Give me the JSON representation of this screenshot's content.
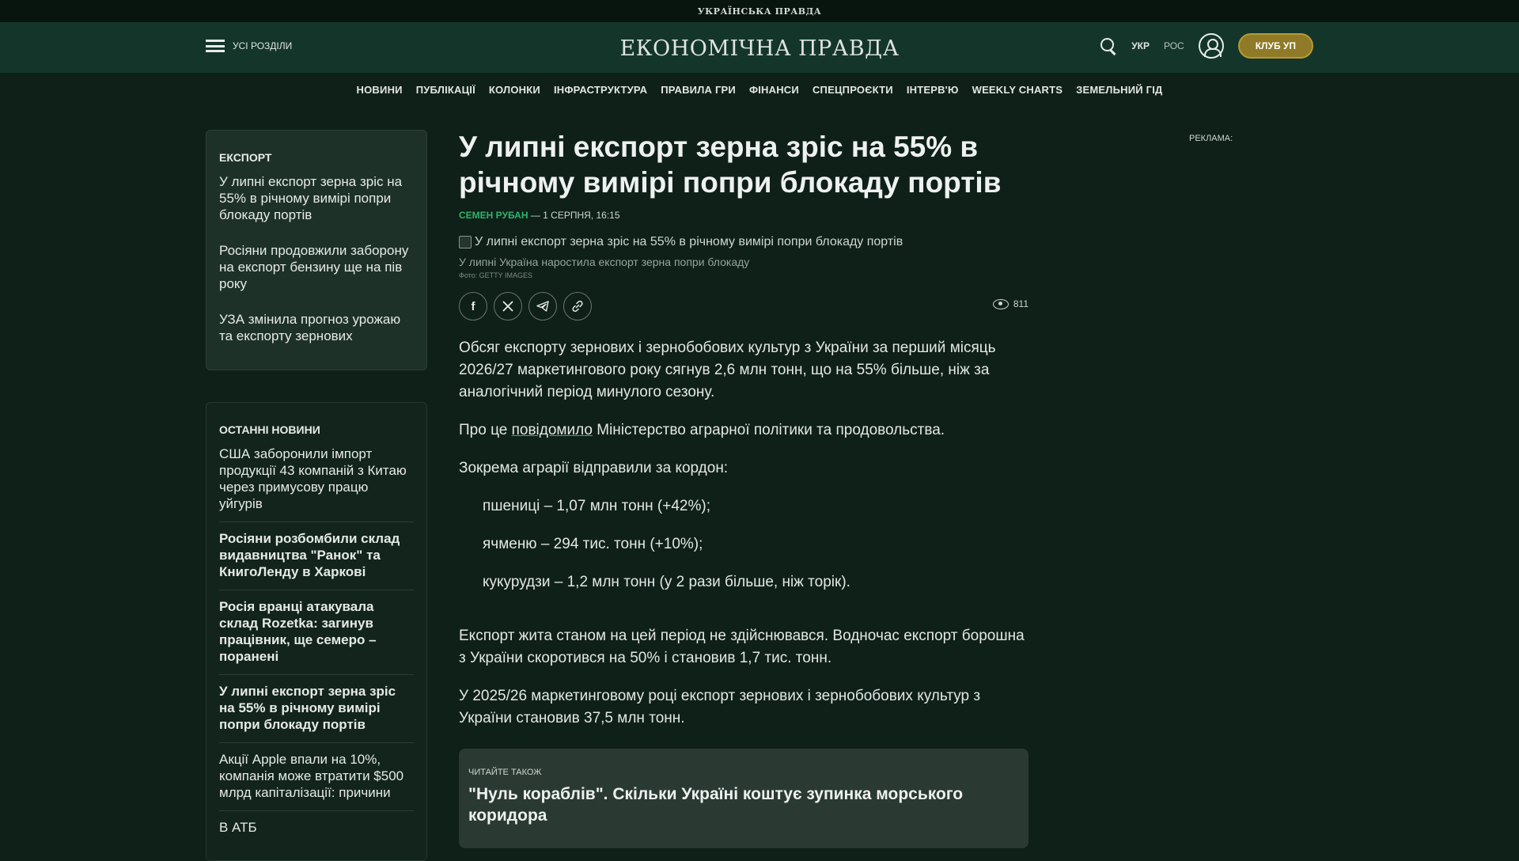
{
  "topbar": {
    "brand": "УКРАЇНСЬКА ПРАВДА"
  },
  "header": {
    "menu_label": "УСІ РОЗДІЛИ",
    "logo": "ЕКОНОМІЧНА ПРАВДА",
    "lang_ukr": "УКР",
    "lang_ros": "РОС",
    "club_button": "КЛУБ УП"
  },
  "nav": {
    "items": [
      "НОВИНИ",
      "ПУБЛІКАЦІЇ",
      "КОЛОНКИ",
      "ІНФРАСТРУКТУРА",
      "ПРАВИЛА ГРИ",
      "ФІНАНСИ",
      "СПЕЦПРОЄКТИ",
      "ІНТЕРВ'Ю",
      "WEEKLY CHARTS",
      "ЗЕМЕЛЬНИЙ ГІД"
    ]
  },
  "export_box": {
    "title": "ЕКСПОРТ",
    "items": [
      "У липні експорт зерна зріс на 55% в річному вимірі попри блокаду портів",
      "Росіяни продовжили заборону на експорт бензину ще на пів року",
      "УЗА змінила прогноз урожаю та експорту зернових"
    ]
  },
  "latest_box": {
    "title": "ОСТАННІ НОВИНИ",
    "items": [
      "США заборонили імпорт продукції 43 компаній з Китаю через примусову працю уйгурів",
      "Росіяни розбомбили склад видавництва \"Ранок\" та КнигоЛенду в Харкові",
      "Росія вранці атакувала склад Rozetka: загинув працівник, ще семеро – поранені",
      "У липні експорт зерна зріс на 55% в річному вимірі попри блокаду портів",
      "Акції Apple впали на 10%, компанія може втратити $500 млрд капіталізації: причини",
      "В АТБ"
    ]
  },
  "article": {
    "title": "У липні експорт зерна зріс на 55% в річному вимірі попри блокаду портів",
    "author": "СЕМЕН РУБАН",
    "date": "— 1 СЕРПНЯ, 16:15",
    "image_alt": "У липні експорт зерна зріс на 55% в річному вимірі попри блокаду портів",
    "caption": "У липні Україна наростила експорт зерна попри блокаду",
    "photo_credit": "Фото: GETTY IMAGES",
    "views": "811",
    "p1": "Обсяг експорту зернових і зернобобових культур з України за перший місяць 2026/27 маркетингового року сягнув 2,6 млн тонн, що на 55% більше, ніж за аналогічний період минулого сезону.",
    "p2_before": "Про це ",
    "p2_link": "повідомило",
    "p2_after": " Міністерство аграрної політики та продовольства.",
    "p3": "Зокрема аграрії відправили за кордон:",
    "list": [
      "пшениці – 1,07 млн тонн (+42%);",
      "ячменю – 294 тис. тонн (+10%);",
      "кукурудзи – 1,2 млн тонн (у 2 рази більше, ніж торік)."
    ],
    "p4": "Експорт жита станом на цей період не здійснювався. Водночас експорт борошна з України скоротився на 50% і становив 1,7 тис. тонн.",
    "p5": "У 2025/26 маркетинговому році експорт зернових і зернобобових культур з України становив 37,5 млн тонн.",
    "read_also_label": "ЧИТАЙТЕ ТАКОЖ",
    "read_also_title": "\"Нуль кораблів\". Скільки Україні коштує зупинка морського коридора"
  },
  "ad": {
    "label": "РЕКЛАМА:"
  },
  "colors": {
    "background": "#0f2019",
    "header": "#14362a",
    "accent_green": "#2fb36f",
    "club_gold": "#8f7a28"
  },
  "icons": [
    "burger-menu-icon",
    "search-icon",
    "user-icon",
    "facebook-icon",
    "x-icon",
    "telegram-icon",
    "link-icon",
    "eye-icon"
  ]
}
